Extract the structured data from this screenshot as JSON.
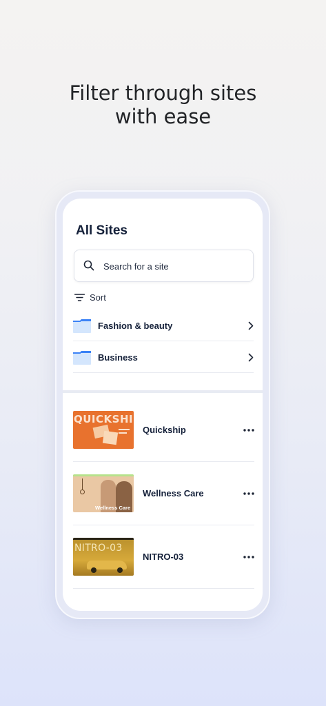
{
  "headline": {
    "line1": "Filter through sites",
    "line2": "with ease"
  },
  "screen": {
    "title": "All Sites",
    "search": {
      "placeholder": "Search for a site"
    },
    "sort": {
      "label": "Sort",
      "icon": "filter-lines-icon"
    },
    "folders": [
      {
        "label": "Fashion & beauty",
        "icon": "folder-icon"
      },
      {
        "label": "Business",
        "icon": "folder-icon"
      }
    ],
    "sites": [
      {
        "name": "Quickship",
        "thumb_text": "QUICKSHIP",
        "thumb_color": "#e8722e"
      },
      {
        "name": "Wellness Care",
        "thumb_text": "Wellness Care",
        "thumb_color": "#e9c7a2"
      },
      {
        "name": "NITRO-03",
        "thumb_text": "NITRO-03",
        "thumb_color": "#c99b2c"
      }
    ]
  },
  "colors": {
    "primary_text": "#15213a",
    "folder_blue": "#3b82f6",
    "folder_light": "#d4e6fd"
  }
}
